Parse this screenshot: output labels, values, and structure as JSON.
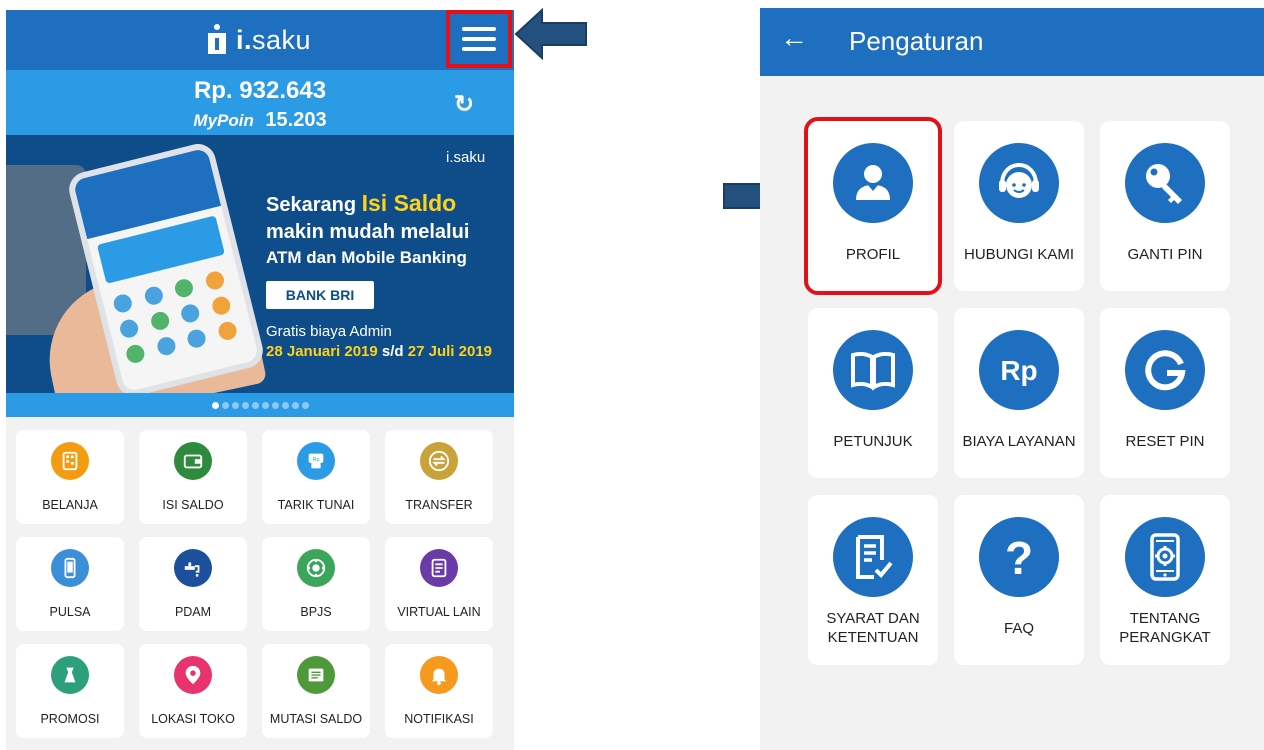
{
  "left": {
    "app_name_bold": "i.",
    "app_name_rest": "saku",
    "balance": "Rp. 932.643",
    "poin_brand": "MyPoin",
    "poin_value": "15.203",
    "refresh_glyph": "↻",
    "banner": {
      "brand": "i.saku",
      "line1_a": "Sekarang",
      "line1_b": "Isi Saldo",
      "line2": "makin mudah melalui",
      "line3": "ATM dan Mobile Banking",
      "bank": "BANK BRI",
      "line4": "Gratis biaya Admin",
      "date_start": "28 Januari 2019",
      "date_sep": "s/d",
      "date_end": "27 Juli 2019",
      "dots_count": 10,
      "active_dot": 0
    },
    "menu": [
      {
        "label": "BELANJA",
        "icon": "shop-qr-icon",
        "color": "#f39c12"
      },
      {
        "label": "ISI SALDO",
        "icon": "wallet-icon",
        "color": "#2e8b3e"
      },
      {
        "label": "TARIK TUNAI",
        "icon": "atm-icon",
        "color": "#2c9be6"
      },
      {
        "label": "TRANSFER",
        "icon": "transfer-icon",
        "color": "#c9a23a"
      },
      {
        "label": "PULSA",
        "icon": "phone-icon",
        "color": "#3a8fd8"
      },
      {
        "label": "PDAM",
        "icon": "faucet-icon",
        "color": "#1c4f9c"
      },
      {
        "label": "BPJS",
        "icon": "bpjs-icon",
        "color": "#3ba55c"
      },
      {
        "label": "VIRTUAL LAIN",
        "icon": "document-icon",
        "color": "#6a3aa8"
      },
      {
        "label": "PROMOSI",
        "icon": "promo-icon",
        "color": "#2ba07a"
      },
      {
        "label": "LOKASI TOKO",
        "icon": "location-icon",
        "color": "#e8336c"
      },
      {
        "label": "MUTASI SALDO",
        "icon": "statement-icon",
        "color": "#4e9a3a"
      },
      {
        "label": "NOTIFIKASI",
        "icon": "bell-icon",
        "color": "#f59a1e"
      }
    ]
  },
  "right": {
    "back_glyph": "←",
    "title": "Pengaturan",
    "items": [
      {
        "line1": "PROFIL",
        "line2": "",
        "icon": "user-icon"
      },
      {
        "line1": "HUBUNGI KAMI",
        "line2": "",
        "icon": "headset-icon"
      },
      {
        "line1": "GANTI PIN",
        "line2": "",
        "icon": "key-icon"
      },
      {
        "line1": "PETUNJUK",
        "line2": "",
        "icon": "book-icon"
      },
      {
        "line1": "BIAYA LAYANAN",
        "line2": "",
        "icon": "rupiah-icon"
      },
      {
        "line1": "RESET PIN",
        "line2": "",
        "icon": "reset-icon"
      },
      {
        "line1": "SYARAT DAN",
        "line2": "KETENTUAN",
        "icon": "terms-icon"
      },
      {
        "line1": "FAQ",
        "line2": "",
        "icon": "question-icon"
      },
      {
        "line1": "TENTANG",
        "line2": "PERANGKAT",
        "icon": "device-settings-icon"
      }
    ]
  },
  "highlight_color": "#e3101a",
  "arrow_color": "#23507f"
}
